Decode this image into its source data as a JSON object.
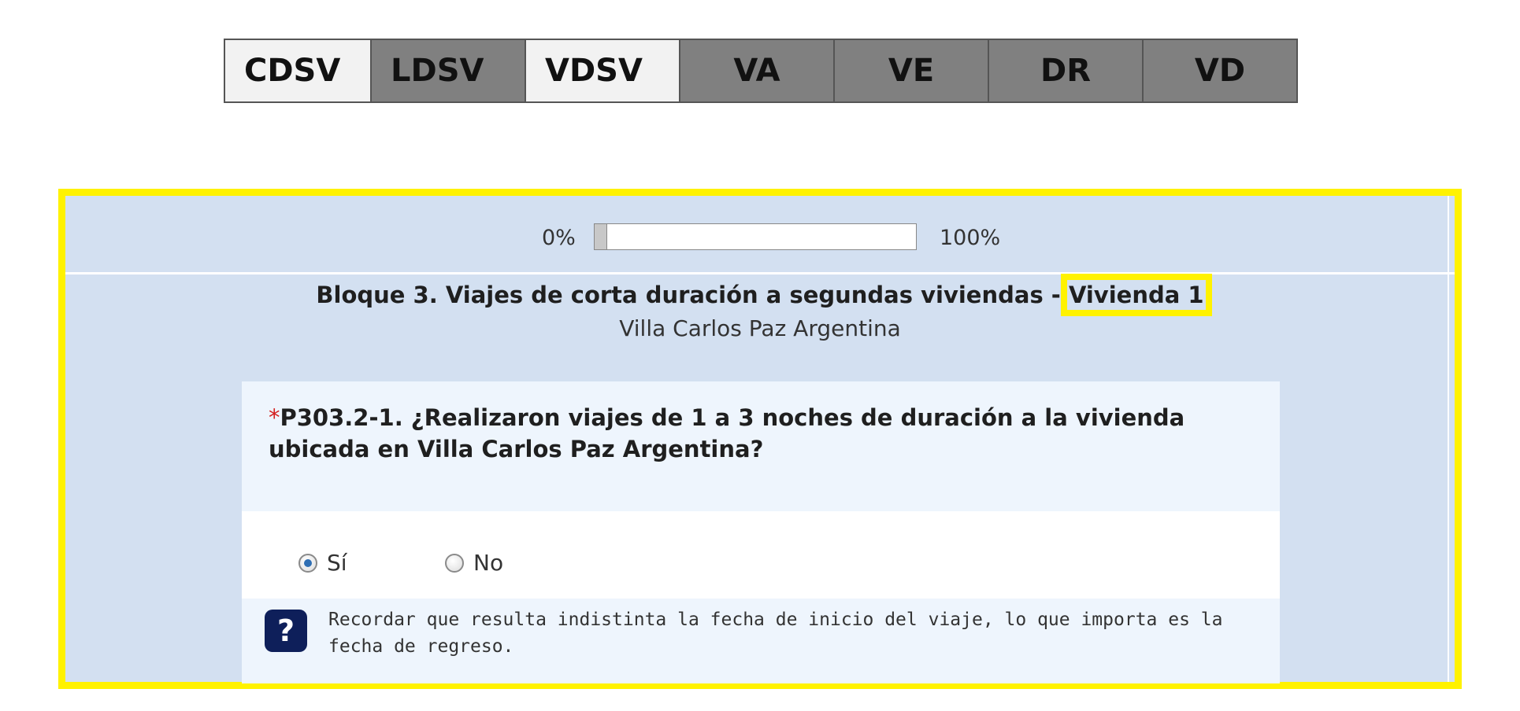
{
  "tabs": [
    {
      "label": "CDSV"
    },
    {
      "label": "LDSV"
    },
    {
      "label": "VDSV"
    },
    {
      "label": "VA"
    },
    {
      "label": "VE"
    },
    {
      "label": "DR"
    },
    {
      "label": "VD"
    }
  ],
  "progress": {
    "start_label": "0%",
    "end_label": "100%",
    "value_percent": 4
  },
  "block": {
    "title_main": "Bloque 3. Viajes de corta duración a segundas viviendas - ",
    "title_highlight": "Vivienda 1",
    "subtitle": "Villa Carlos Paz Argentina"
  },
  "question": {
    "required_mark": "*",
    "text": "P303.2-1. ¿Realizaron viajes de 1 a 3 noches de duración a la vivienda ubicada en Villa Carlos Paz Argentina?",
    "options": [
      {
        "label": "Sí",
        "selected": true
      },
      {
        "label": "No",
        "selected": false
      }
    ],
    "help_icon": "question-mark-icon",
    "help_icon_glyph": "?",
    "help_text": "Recordar que resulta indistinta la fecha de inicio del viaje, lo que importa es la fecha de regreso."
  },
  "colors": {
    "highlight": "#fff200",
    "panel_background": "#d3e0f1",
    "card_background": "#eef5fd",
    "tab_light": "#f2f2f2",
    "tab_dark": "#808080",
    "help_icon": "#0e1f5a",
    "required": "#d42020"
  }
}
